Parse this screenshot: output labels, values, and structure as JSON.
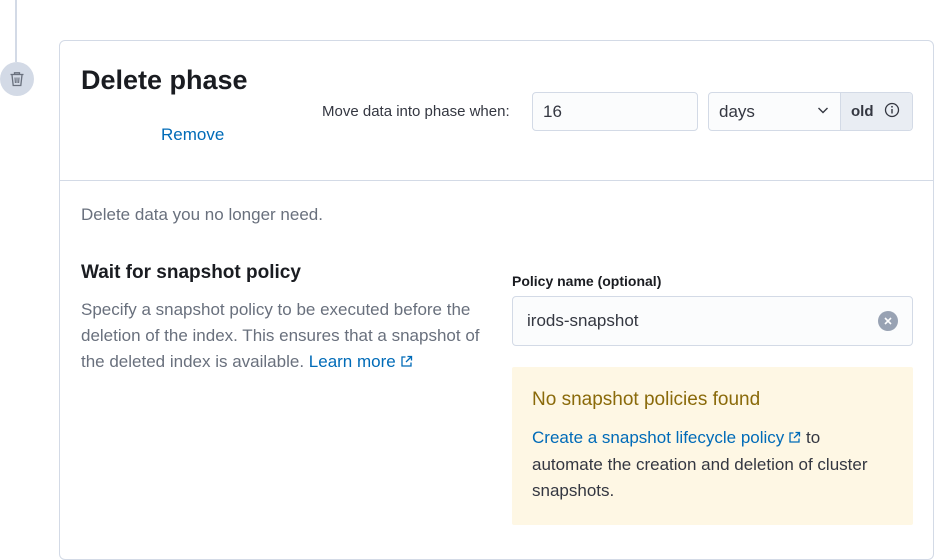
{
  "phase": {
    "title": "Delete phase",
    "remove_label": "Remove",
    "move_label": "Move data into phase when:",
    "age_value": "16",
    "age_unit": "days",
    "age_suffix": "old"
  },
  "description": "Delete data you no longer need.",
  "snapshot": {
    "title": "Wait for snapshot policy",
    "text": "Specify a snapshot policy to be executed before the deletion of the index. This ensures that a snapshot of the deleted index is available.",
    "learn_more_line1": "Learn",
    "learn_more_line2": "more",
    "field_label": "Policy name (optional)",
    "field_value": "irods-snapshot"
  },
  "callout": {
    "title": "No snapshot policies found",
    "link": "Create a snapshot lifecycle policy",
    "text": "to automate the creation and deletion of cluster snapshots."
  },
  "colors": {
    "link": "#006bb8",
    "callout_bg": "#fef7e4",
    "callout_title": "#8a6a0a",
    "border": "#d3dae6"
  },
  "icons": {
    "timeline": "trash-icon",
    "select": "chevron-down-icon",
    "info": "info-icon",
    "clear": "clear-icon",
    "external": "external-link-icon"
  }
}
